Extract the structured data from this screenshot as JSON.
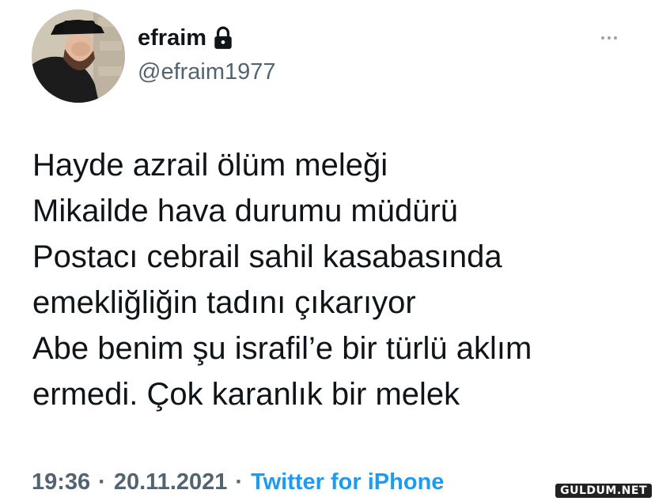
{
  "user": {
    "display_name": "efraim",
    "username": "@efraim1977",
    "avatar_icon": "user-avatar",
    "protected_icon": "lock-icon"
  },
  "more_icon": "more-horizontal-icon",
  "tweet": {
    "lines": [
      "Hayde azrail ölüm meleği",
      "Mikailde hava durumu müdürü",
      "Postacı cebrail sahil kasabasında",
      "emekliğliğin tadını çıkarıyor",
      "Abe benim şu israfil’e bir türlü aklım",
      "ermedi. Çok karanlık bir melek"
    ]
  },
  "meta": {
    "time": "19:36",
    "separator": "·",
    "date": "20.11.2021",
    "source": "Twitter for iPhone"
  },
  "watermark": "GULDUM.NET",
  "colors": {
    "text": "#0f1419",
    "secondary": "#536471",
    "link": "#1d9bf0"
  }
}
